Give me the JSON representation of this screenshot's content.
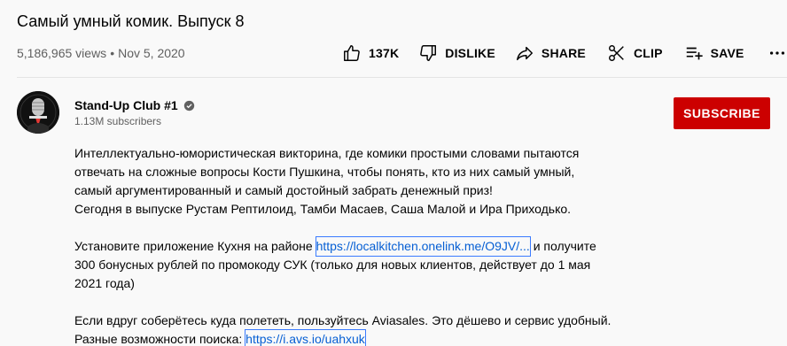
{
  "video": {
    "title": "Самый умный комик. Выпуск 8",
    "views": "5,186,965 views",
    "date": "Nov 5, 2020"
  },
  "actions": {
    "like_count": "137K",
    "dislike_label": "DISLIKE",
    "share_label": "SHARE",
    "clip_label": "CLIP",
    "save_label": "SAVE"
  },
  "channel": {
    "name": "Stand-Up Club #1",
    "subscribers": "1.13M subscribers",
    "subscribe_label": "SUBSCRIBE"
  },
  "description": {
    "para1": [
      "Интеллектуально-юмористическая викторина, где комики простыми словами пытаются",
      "отвечать на сложные вопросы Кости Пушкина, чтобы понять, кто из них самый умный,",
      "самый аргументированный и самый достойный забрать денежный приз!",
      "Сегодня в выпуске Рустам Рептилоид, Тамби Масаев, Саша Малой и Ира Приходько."
    ],
    "para2_pre": "Установите приложение Кухня на районе ",
    "para2_link": "https://localkitchen.onelink.me/O9JV/...",
    "para2_post": " и получите",
    "para2_line2": "300 бонусных рублей по промокоду СУК (только для новых клиентов, действует до 1 мая",
    "para2_line3": "2021 года)",
    "para3_line1": "Если вдруг соберётесь куда полететь, пользуйтесь Aviasales. Это дёшево и сервис удобный.",
    "para3_pre": "Разные возможности поиска: ",
    "para3_link": "https://i.avs.io/uahxuk"
  },
  "colors": {
    "subscribe_bg": "#cc0000",
    "link": "#065fd4",
    "meta_text": "#606060"
  }
}
